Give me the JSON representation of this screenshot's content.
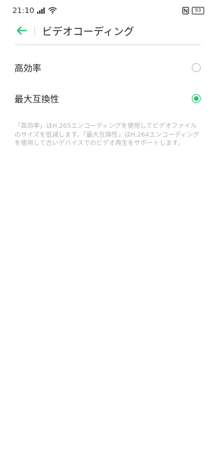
{
  "status_bar": {
    "time": "21:10",
    "battery": "93"
  },
  "header": {
    "title": "ビデオコーディング",
    "back_icon": "arrow-left-icon",
    "accent_color": "#2dbf78"
  },
  "options": [
    {
      "label": "高効率",
      "selected": false
    },
    {
      "label": "最大互換性",
      "selected": true
    }
  ],
  "description": "「高効率」はH.265エンコーディングを使用してビデオファイルのサイズを低減します。「最大互換性」はH.264エンコーディングを使用して古いデバイスでのビデオ再生をサポートします。"
}
